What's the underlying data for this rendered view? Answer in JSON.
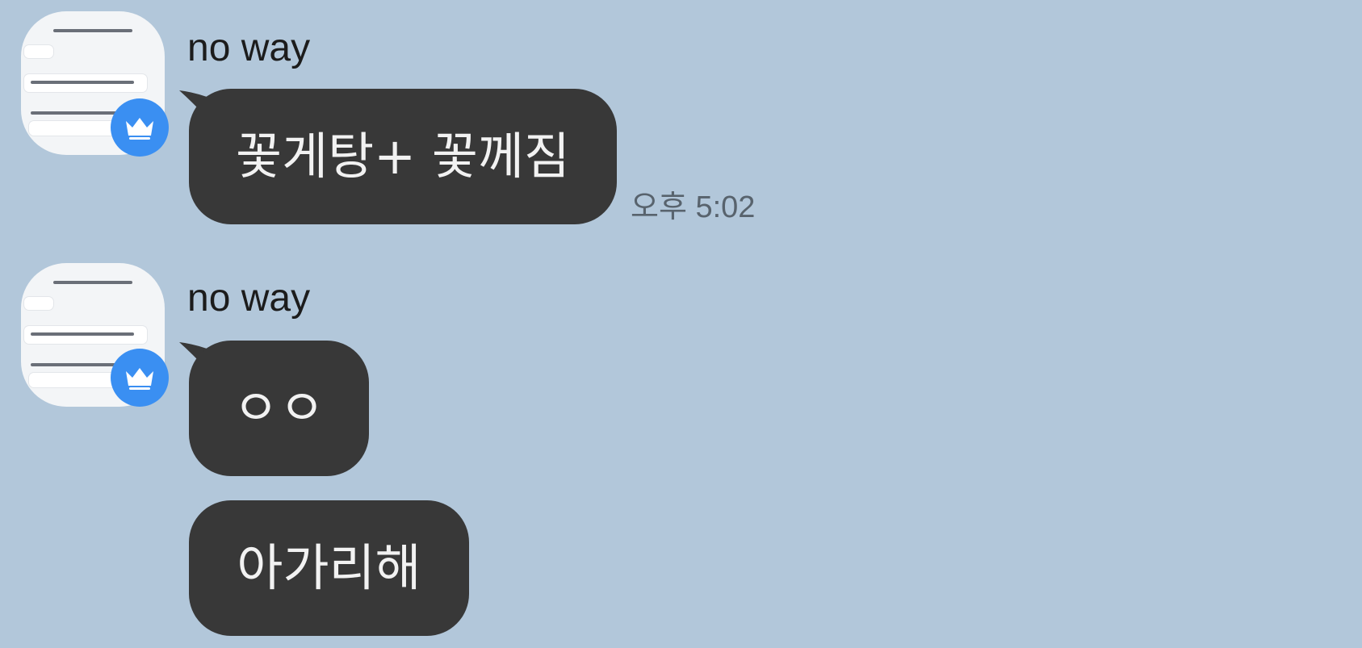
{
  "messages": [
    {
      "sender": "no way",
      "bubbles": [
        {
          "text": "꽃게탕+ 꽃께짐",
          "time": "오후 5:02"
        }
      ]
    },
    {
      "sender": "no way",
      "bubbles": [
        {
          "text": "ㅇㅇ"
        },
        {
          "text": "아가리해"
        }
      ]
    }
  ],
  "colors": {
    "background": "#b2c7da",
    "bubble": "#383838",
    "bubble_text": "#f2f2f2",
    "badge": "#3a8ff2"
  },
  "icons": {
    "badge": "crown-icon"
  }
}
